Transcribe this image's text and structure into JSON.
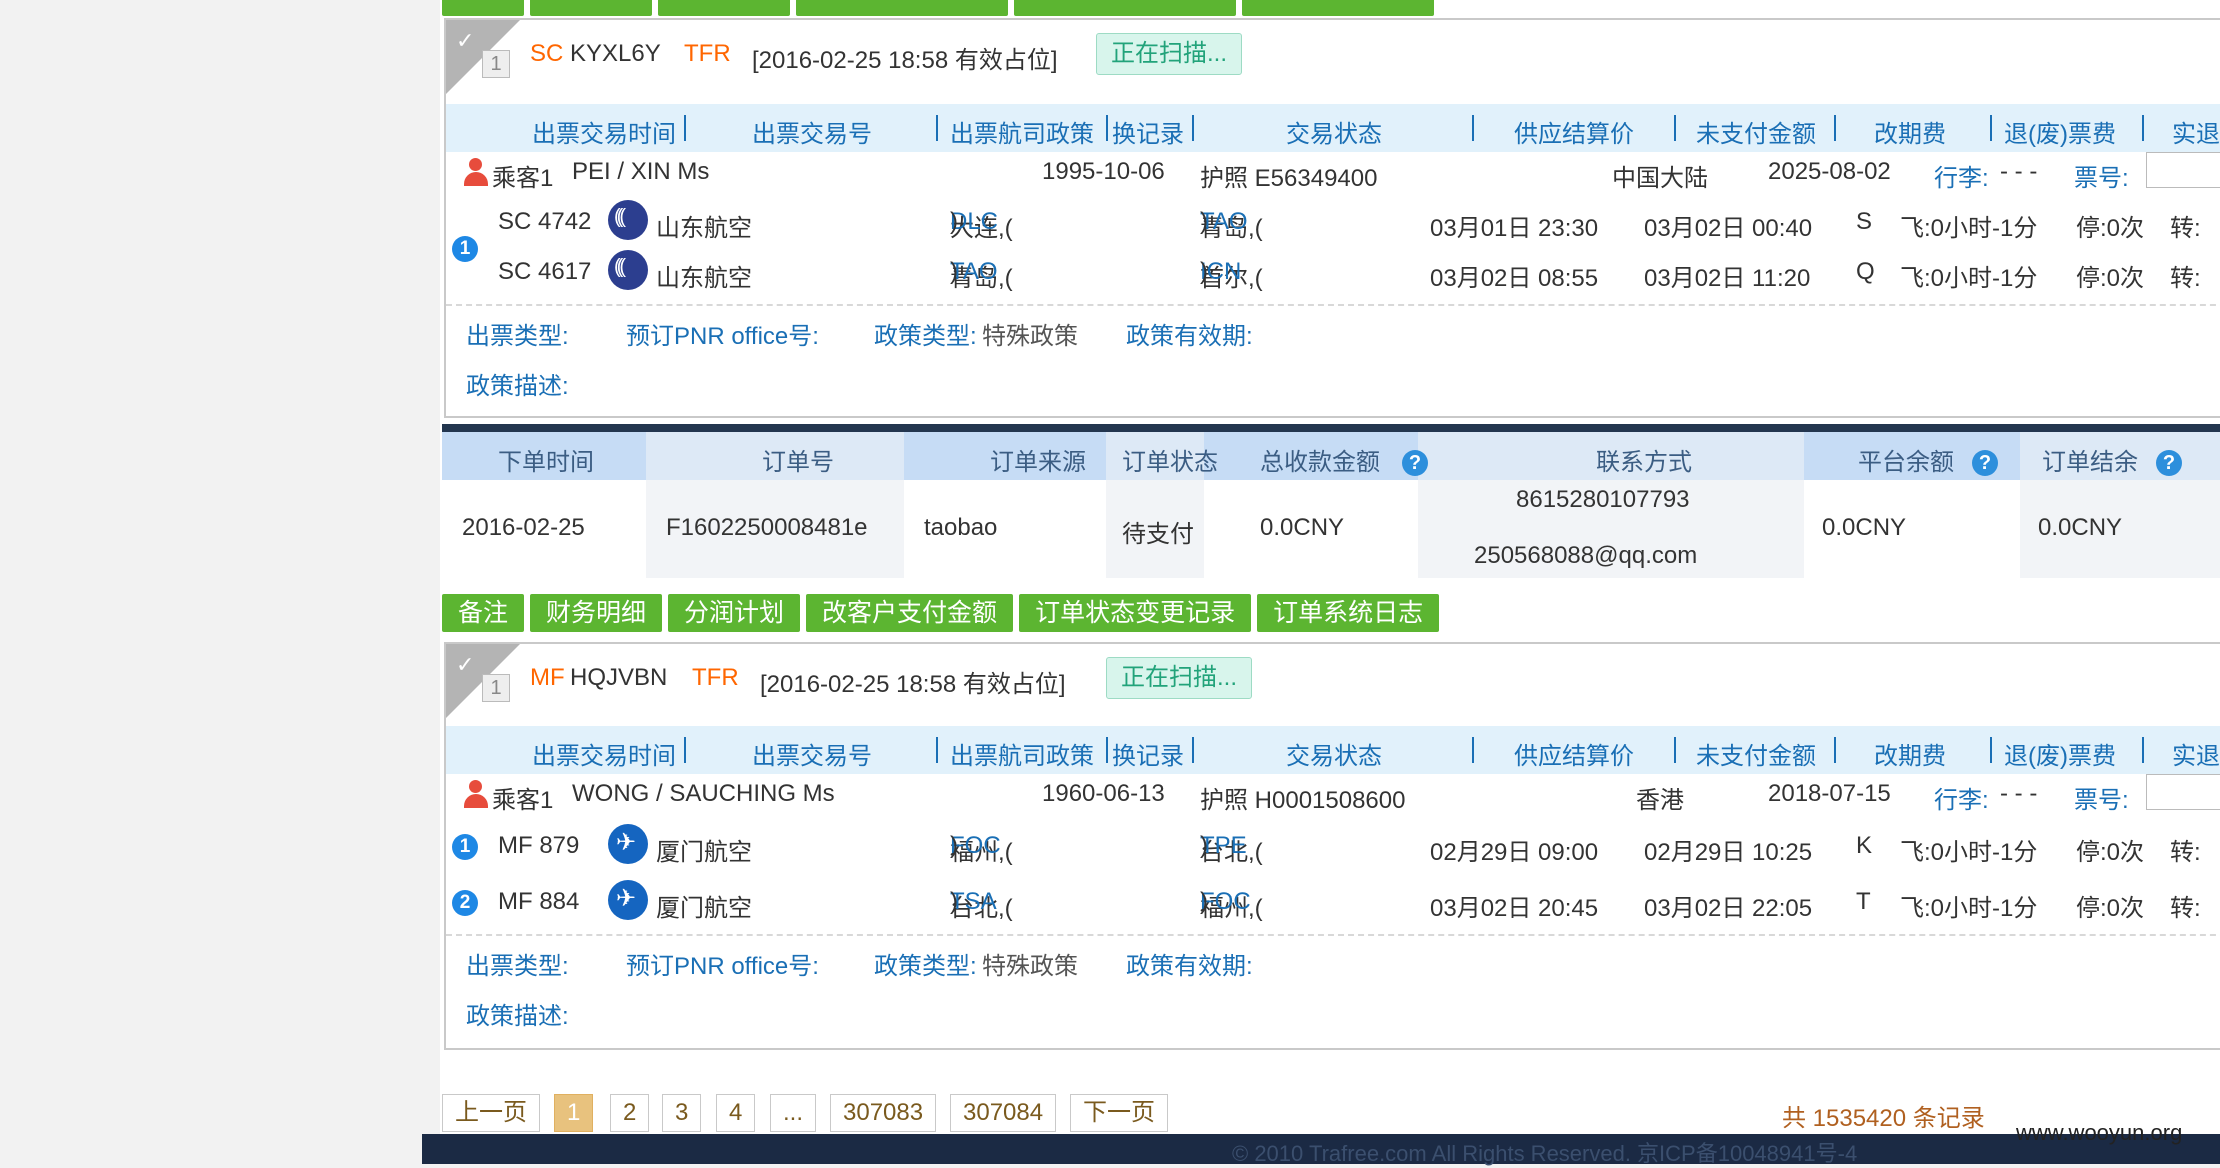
{
  "ticket1": {
    "index": "1",
    "airline_code": "SC",
    "pnr": "KYXL6Y",
    "trip_type": "TFR",
    "time_note": "[2016-02-25 18:58 有效占位]",
    "scan_label": "正在扫描...",
    "headers": [
      "出票交易时间",
      "出票交易号",
      "出票航司政策",
      "换记录",
      "交易状态",
      "供应结算价",
      "未支付金额",
      "改期费",
      "退(废)票费",
      "实退"
    ],
    "passenger": {
      "label": "乘客1",
      "name": "PEI / XIN Ms",
      "birth": "1995-10-06",
      "doc": "护照 E56349400",
      "nationality": "中国大陆",
      "expiry": "2025-08-02",
      "baggage_label": "行李:",
      "baggage_value": "- - -",
      "ticket_label": "票号:"
    },
    "segment_badge": "1",
    "flights": [
      {
        "no": "SC 4742",
        "airline": "山东航空",
        "from_city": "大连,(",
        "from_code": "DLC",
        "to_city": "青岛,(",
        "to_code": "TAO",
        "close": ")",
        "dep": "03月01日 23:30",
        "arr": "03月02日 00:40",
        "cabin": "S",
        "fly": "飞:0小时-1分",
        "stop": "停:0次",
        "transfer": "转:"
      },
      {
        "no": "SC 4617",
        "airline": "山东航空",
        "from_city": "青岛,(",
        "from_code": "TAO",
        "to_city": "首尔,(",
        "to_code": "ICN",
        "close": ")",
        "dep": "03月02日 08:55",
        "arr": "03月02日 11:20",
        "cabin": "Q",
        "fly": "飞:0小时-1分",
        "stop": "停:0次",
        "transfer": "转:"
      }
    ],
    "policy": {
      "ticket_type": "出票类型:",
      "office": "预订PNR office号:",
      "policy_type_label": "政策类型:",
      "policy_type_value": "特殊政策",
      "validity": "政策有效期:",
      "desc": "政策描述:"
    }
  },
  "order": {
    "headers": [
      "下单时间",
      "订单号",
      "订单来源",
      "订单状态",
      "总收款金额",
      "联系方式",
      "平台余额",
      "订单结余"
    ],
    "help_icon": "?",
    "values": {
      "time": "2016-02-25",
      "id": "F1602250008481e",
      "source": "taobao",
      "status": "待支付",
      "total": "0.0CNY",
      "phone": "8615280107793",
      "email": "250568088@qq.com",
      "balance": "0.0CNY",
      "remain": "0.0CNY"
    }
  },
  "actions": [
    "备注",
    "财务明细",
    "分润计划",
    "改客户支付金额",
    "订单状态变更记录",
    "订单系统日志"
  ],
  "ticket2": {
    "index": "1",
    "airline_code": "MF",
    "pnr": "HQJVBN",
    "trip_type": "TFR",
    "time_note": "[2016-02-25 18:58 有效占位]",
    "scan_label": "正在扫描...",
    "headers": [
      "出票交易时间",
      "出票交易号",
      "出票航司政策",
      "换记录",
      "交易状态",
      "供应结算价",
      "未支付金额",
      "改期费",
      "退(废)票费",
      "实退"
    ],
    "passenger": {
      "label": "乘客1",
      "name": "WONG / SAUCHING Ms",
      "birth": "1960-06-13",
      "doc": "护照 H0001508600",
      "nationality": "香港",
      "expiry": "2018-07-15",
      "baggage_label": "行李:",
      "baggage_value": "- - -",
      "ticket_label": "票号:"
    },
    "flights": [
      {
        "badge": "1",
        "no": "MF 879",
        "airline": "厦门航空",
        "from_city": "福州,(",
        "from_code": "FOC",
        "to_city": "台北,(",
        "to_code": "TPE",
        "close": ")",
        "dep": "02月29日 09:00",
        "arr": "02月29日 10:25",
        "cabin": "K",
        "fly": "飞:0小时-1分",
        "stop": "停:0次",
        "transfer": "转:"
      },
      {
        "badge": "2",
        "no": "MF 884",
        "airline": "厦门航空",
        "from_city": "台北,(",
        "from_code": "TSA",
        "to_city": "福州,(",
        "to_code": "FOC",
        "close": ")",
        "dep": "03月02日 20:45",
        "arr": "03月02日 22:05",
        "cabin": "T",
        "fly": "飞:0小时-1分",
        "stop": "停:0次",
        "transfer": "转:"
      }
    ],
    "policy": {
      "ticket_type": "出票类型:",
      "office": "预订PNR office号:",
      "policy_type_label": "政策类型:",
      "policy_type_value": "特殊政策",
      "validity": "政策有效期:",
      "desc": "政策描述:"
    }
  },
  "pager": {
    "prev": "上一页",
    "pages": [
      "1",
      "2",
      "3",
      "4",
      "...",
      "307083",
      "307084"
    ],
    "next": "下一页",
    "total": "共 1535420 条记录"
  },
  "footer": {
    "copyright": "© 2010 Trafree.com All Rights Reserved. 京ICP备10048941号-4"
  },
  "watermark": "www.wooyun.org"
}
